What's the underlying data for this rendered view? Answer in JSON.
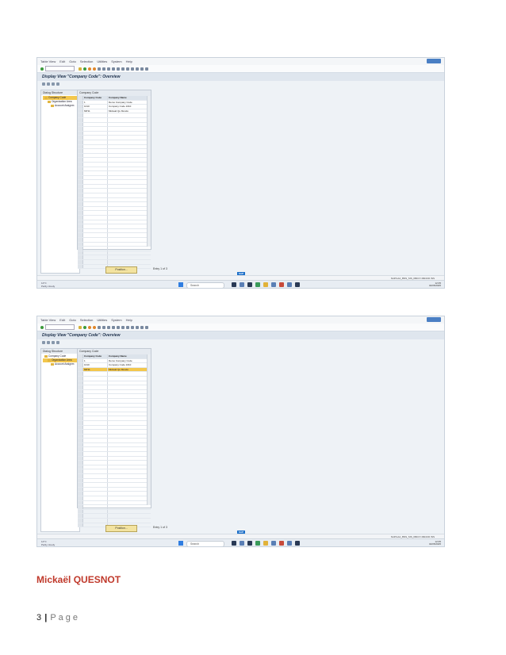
{
  "screenshots": [
    {
      "menu": [
        "Table View",
        "Edit",
        "Goto",
        "Selection",
        "Utilities",
        "System",
        "Help"
      ],
      "title": "Display View \"Company Code\": Overview",
      "tree_header": "Dialog Structure",
      "tree": [
        "Company Code",
        "Organization Area",
        "Account Assignm"
      ],
      "tree_selected": 0,
      "table_label": "Company Code",
      "columns": [
        "Company Code",
        "Company Name"
      ],
      "rows": [
        [
          "1",
          "Demo Company Code"
        ],
        [
          "1010",
          "Company Code 1010"
        ],
        [
          "MP11",
          "Mickaël Qu Mondo"
        ]
      ],
      "selected_row": -1,
      "position_button": "Position...",
      "entries": "Entry 1 of 3",
      "status": "SAP/LAA_BNS_SIS_0804 ▾ 4604CD  INS",
      "search": "Search",
      "weather_temp": "14°C",
      "weather_desc": "Partly cloudy",
      "clock_time": "12:05",
      "clock_date": "02/05/2025"
    },
    {
      "menu": [
        "Table View",
        "Edit",
        "Goto",
        "Selection",
        "Utilities",
        "System",
        "Help"
      ],
      "title": "Display View \"Company Code\": Overview",
      "tree_header": "Dialog Structure",
      "tree": [
        "Company Code",
        "Organization Area",
        "Account Assignm"
      ],
      "tree_selected": 1,
      "table_label": "Company Code",
      "columns": [
        "Company Code",
        "Company Name"
      ],
      "rows": [
        [
          "1",
          "Demo Company Code"
        ],
        [
          "1010",
          "Company Code 1010"
        ],
        [
          "MP11",
          "Mickaël Qu Mondo"
        ]
      ],
      "selected_row": 2,
      "position_button": "Position...",
      "entries": "Entry 1 of 3",
      "status": "SAP/LAA_BNS_SIS_0804 ▾ 4604CD  INS",
      "search": "Search",
      "weather_temp": "14°C",
      "weather_desc": "Partly cloudy",
      "clock_time": "12:05",
      "clock_date": "02/05/2025"
    }
  ],
  "author": "Mickaël QUESNOT",
  "footer": {
    "page_number": "3",
    "separator": "|",
    "page_word": "Page"
  }
}
